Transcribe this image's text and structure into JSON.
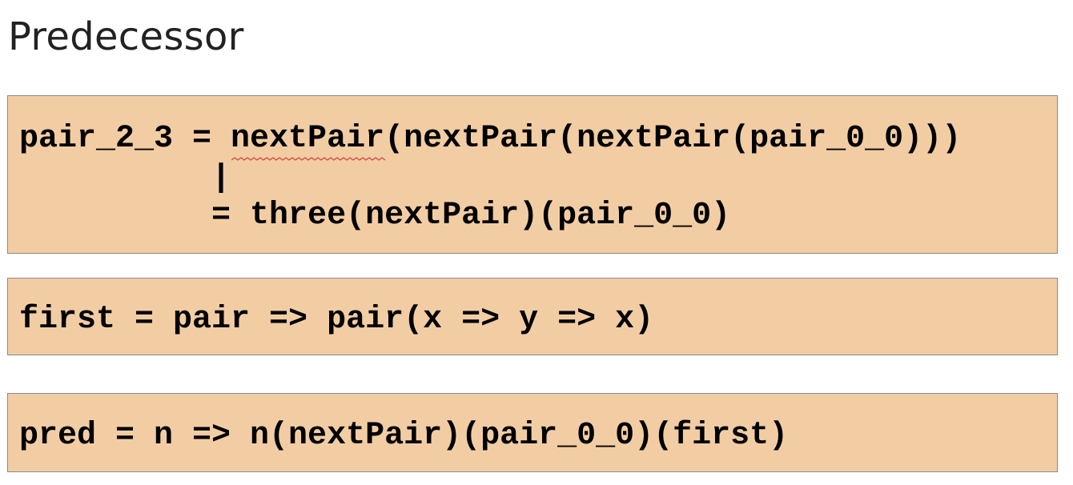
{
  "title": "Predecessor",
  "code_blocks": [
    {
      "lines": [
        "pair_2_3 = nextPair(nextPair(nextPair(pair_0_0)))",
        "          |",
        "          = three(nextPair)(pair_0_0)"
      ]
    },
    {
      "lines": [
        "first = pair => pair(x => y => x)"
      ]
    },
    {
      "lines": [
        "pred = n => n(nextPair)(pair_0_0)(first)"
      ]
    }
  ],
  "colors": {
    "box_background": "#f2cda4",
    "box_border": "#8a8a8a",
    "spellcheck_underline": "#d44040"
  }
}
